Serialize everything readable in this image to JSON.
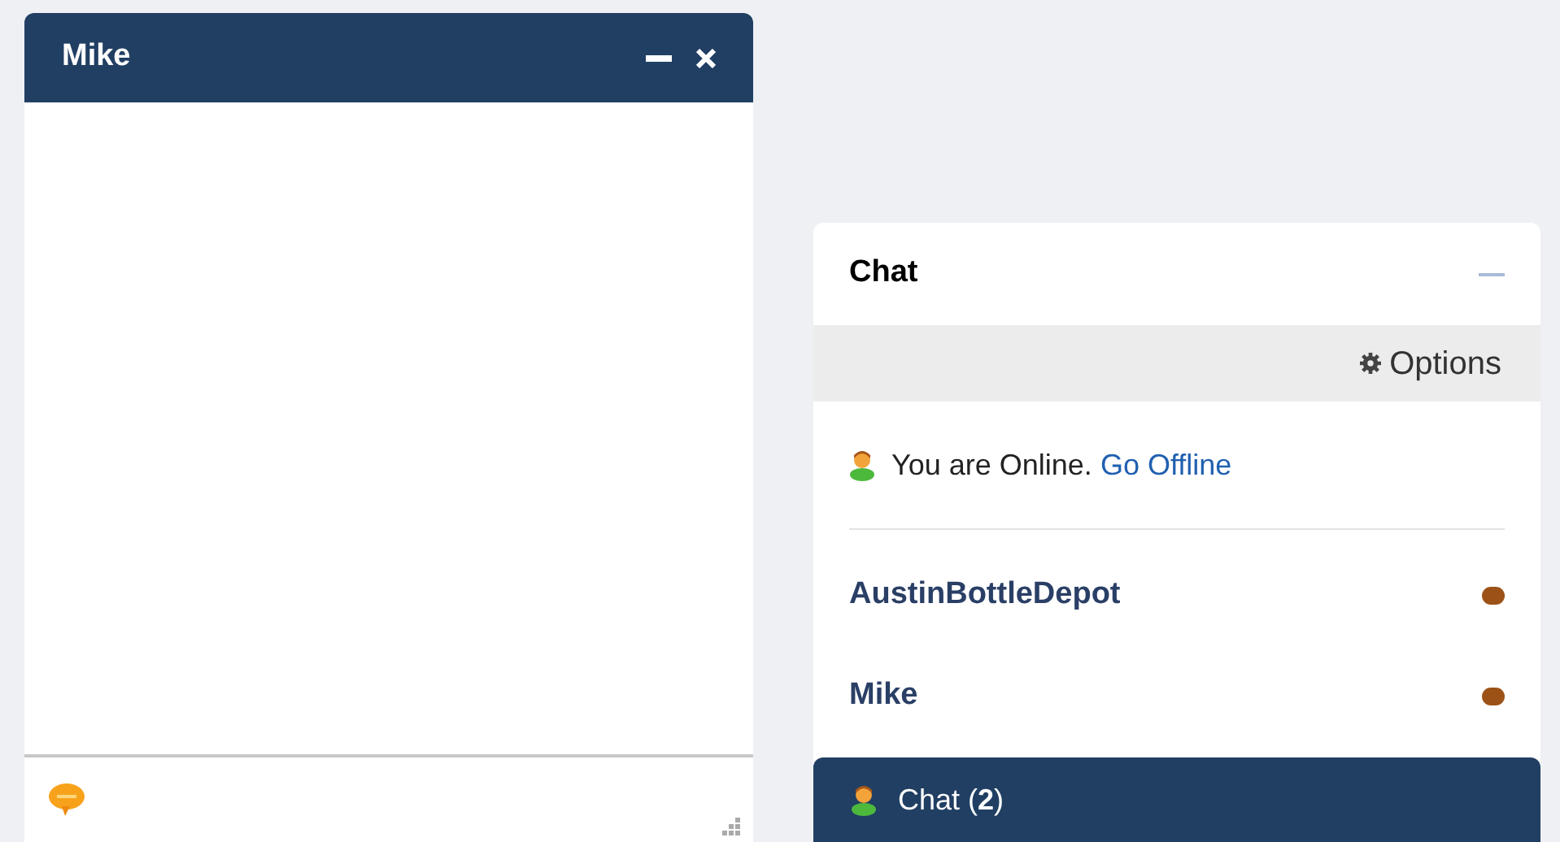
{
  "chat_window": {
    "title": "Mike"
  },
  "chat_panel": {
    "title": "Chat",
    "options": "Options",
    "status_text": "You are Online.",
    "status_link": "Go Offline",
    "contacts": [
      {
        "name": "AustinBottleDepot",
        "color": "#9c5216"
      },
      {
        "name": "Mike",
        "color": "#9c5216"
      }
    ],
    "bar_label": "Chat (**2**)"
  }
}
